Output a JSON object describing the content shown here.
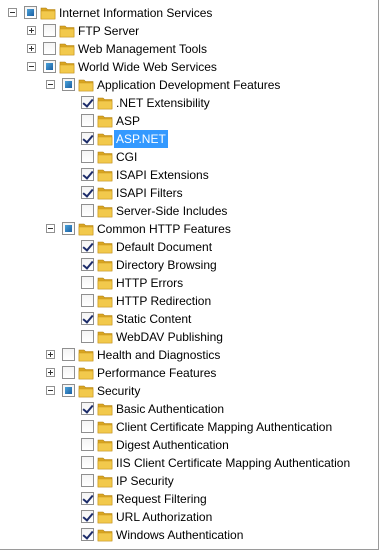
{
  "tree": [
    {
      "id": "iis",
      "label": "Internet Information Services",
      "level": 0,
      "state": "partial",
      "expander": "expanded"
    },
    {
      "id": "ftp",
      "label": "FTP Server",
      "level": 1,
      "state": "unchecked",
      "expander": "collapsed"
    },
    {
      "id": "wmt",
      "label": "Web Management Tools",
      "level": 1,
      "state": "unchecked",
      "expander": "collapsed"
    },
    {
      "id": "www",
      "label": "World Wide Web Services",
      "level": 1,
      "state": "partial",
      "expander": "expanded"
    },
    {
      "id": "adf",
      "label": "Application Development Features",
      "level": 2,
      "state": "partial",
      "expander": "expanded"
    },
    {
      "id": "netext",
      "label": ".NET Extensibility",
      "level": 3,
      "state": "checked"
    },
    {
      "id": "asp",
      "label": "ASP",
      "level": 3,
      "state": "unchecked"
    },
    {
      "id": "aspnet",
      "label": "ASP.NET",
      "level": 3,
      "state": "checked",
      "selected": true
    },
    {
      "id": "cgi",
      "label": "CGI",
      "level": 3,
      "state": "unchecked"
    },
    {
      "id": "isapiext",
      "label": "ISAPI Extensions",
      "level": 3,
      "state": "checked"
    },
    {
      "id": "isapifil",
      "label": "ISAPI Filters",
      "level": 3,
      "state": "checked"
    },
    {
      "id": "ssi",
      "label": "Server-Side Includes",
      "level": 3,
      "state": "unchecked"
    },
    {
      "id": "chf",
      "label": "Common HTTP Features",
      "level": 2,
      "state": "partial",
      "expander": "expanded"
    },
    {
      "id": "defdoc",
      "label": "Default Document",
      "level": 3,
      "state": "checked"
    },
    {
      "id": "dirbrowse",
      "label": "Directory Browsing",
      "level": 3,
      "state": "checked"
    },
    {
      "id": "httperr",
      "label": "HTTP Errors",
      "level": 3,
      "state": "unchecked"
    },
    {
      "id": "httpredir",
      "label": "HTTP Redirection",
      "level": 3,
      "state": "unchecked"
    },
    {
      "id": "static",
      "label": "Static Content",
      "level": 3,
      "state": "checked"
    },
    {
      "id": "webdav",
      "label": "WebDAV Publishing",
      "level": 3,
      "state": "unchecked"
    },
    {
      "id": "health",
      "label": "Health and Diagnostics",
      "level": 2,
      "state": "unchecked",
      "expander": "collapsed"
    },
    {
      "id": "perf",
      "label": "Performance Features",
      "level": 2,
      "state": "unchecked",
      "expander": "collapsed"
    },
    {
      "id": "security",
      "label": "Security",
      "level": 2,
      "state": "partial",
      "expander": "expanded"
    },
    {
      "id": "basicauth",
      "label": "Basic Authentication",
      "level": 3,
      "state": "checked"
    },
    {
      "id": "clientcert",
      "label": "Client Certificate Mapping Authentication",
      "level": 3,
      "state": "unchecked"
    },
    {
      "id": "digest",
      "label": "Digest Authentication",
      "level": 3,
      "state": "unchecked"
    },
    {
      "id": "iisclientcert",
      "label": "IIS Client Certificate Mapping Authentication",
      "level": 3,
      "state": "unchecked"
    },
    {
      "id": "ipsec",
      "label": "IP Security",
      "level": 3,
      "state": "unchecked"
    },
    {
      "id": "reqfilter",
      "label": "Request Filtering",
      "level": 3,
      "state": "checked"
    },
    {
      "id": "urlauth",
      "label": "URL Authorization",
      "level": 3,
      "state": "checked"
    },
    {
      "id": "winauth",
      "label": "Windows Authentication",
      "level": 3,
      "state": "checked"
    }
  ],
  "colors": {
    "selection": "#3399ff",
    "folder_front": "#f2c94c",
    "folder_back": "#d9a521",
    "partial_fill": "#2a7bc4"
  },
  "icons": {
    "folder": "folder-icon",
    "expander_open": "minus-box-icon",
    "expander_closed": "plus-box-icon"
  }
}
